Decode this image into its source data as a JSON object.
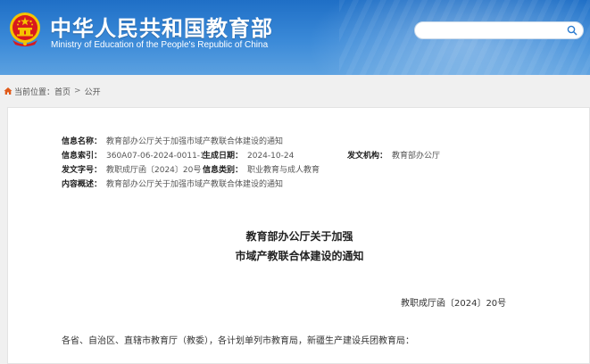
{
  "header": {
    "title": "中华人民共和国教育部",
    "subtitle": "Ministry of Education of the People's Republic of China",
    "emblem_icon": "national-emblem-icon"
  },
  "search": {
    "placeholder": "",
    "icon": "search-icon"
  },
  "breadcrumb": {
    "label": "当前位置：",
    "items": [
      "首页",
      "公开"
    ]
  },
  "meta": {
    "info_name_label": "信息名称：",
    "info_name": "教育部办公厅关于加强市域产教联合体建设的通知",
    "index_label": "信息索引：",
    "index": "360A07-06-2024-0011-1",
    "date_label": "生成日期：",
    "date": "2024-10-24",
    "issuer_label": "发文机构：",
    "issuer": "教育部办公厅",
    "doc_no_label": "发文字号：",
    "doc_no": "教职成厅函〔2024〕20号",
    "category_label": "信息类别：",
    "category": "职业教育与成人教育",
    "summary_label": "内容概述：",
    "summary": "教育部办公厅关于加强市域产教联合体建设的通知"
  },
  "document": {
    "title_line1": "教育部办公厅关于加强",
    "title_line2": "市域产教联合体建设的通知",
    "number": "教职成厅函〔2024〕20号",
    "salutation": "各省、自治区、直辖市教育厅（教委），各计划单列市教育局，新疆生产建设兵团教育局："
  },
  "colors": {
    "header_blue": "#2a7bd0",
    "emblem_red": "#d8191e",
    "emblem_gold": "#f5c400"
  }
}
